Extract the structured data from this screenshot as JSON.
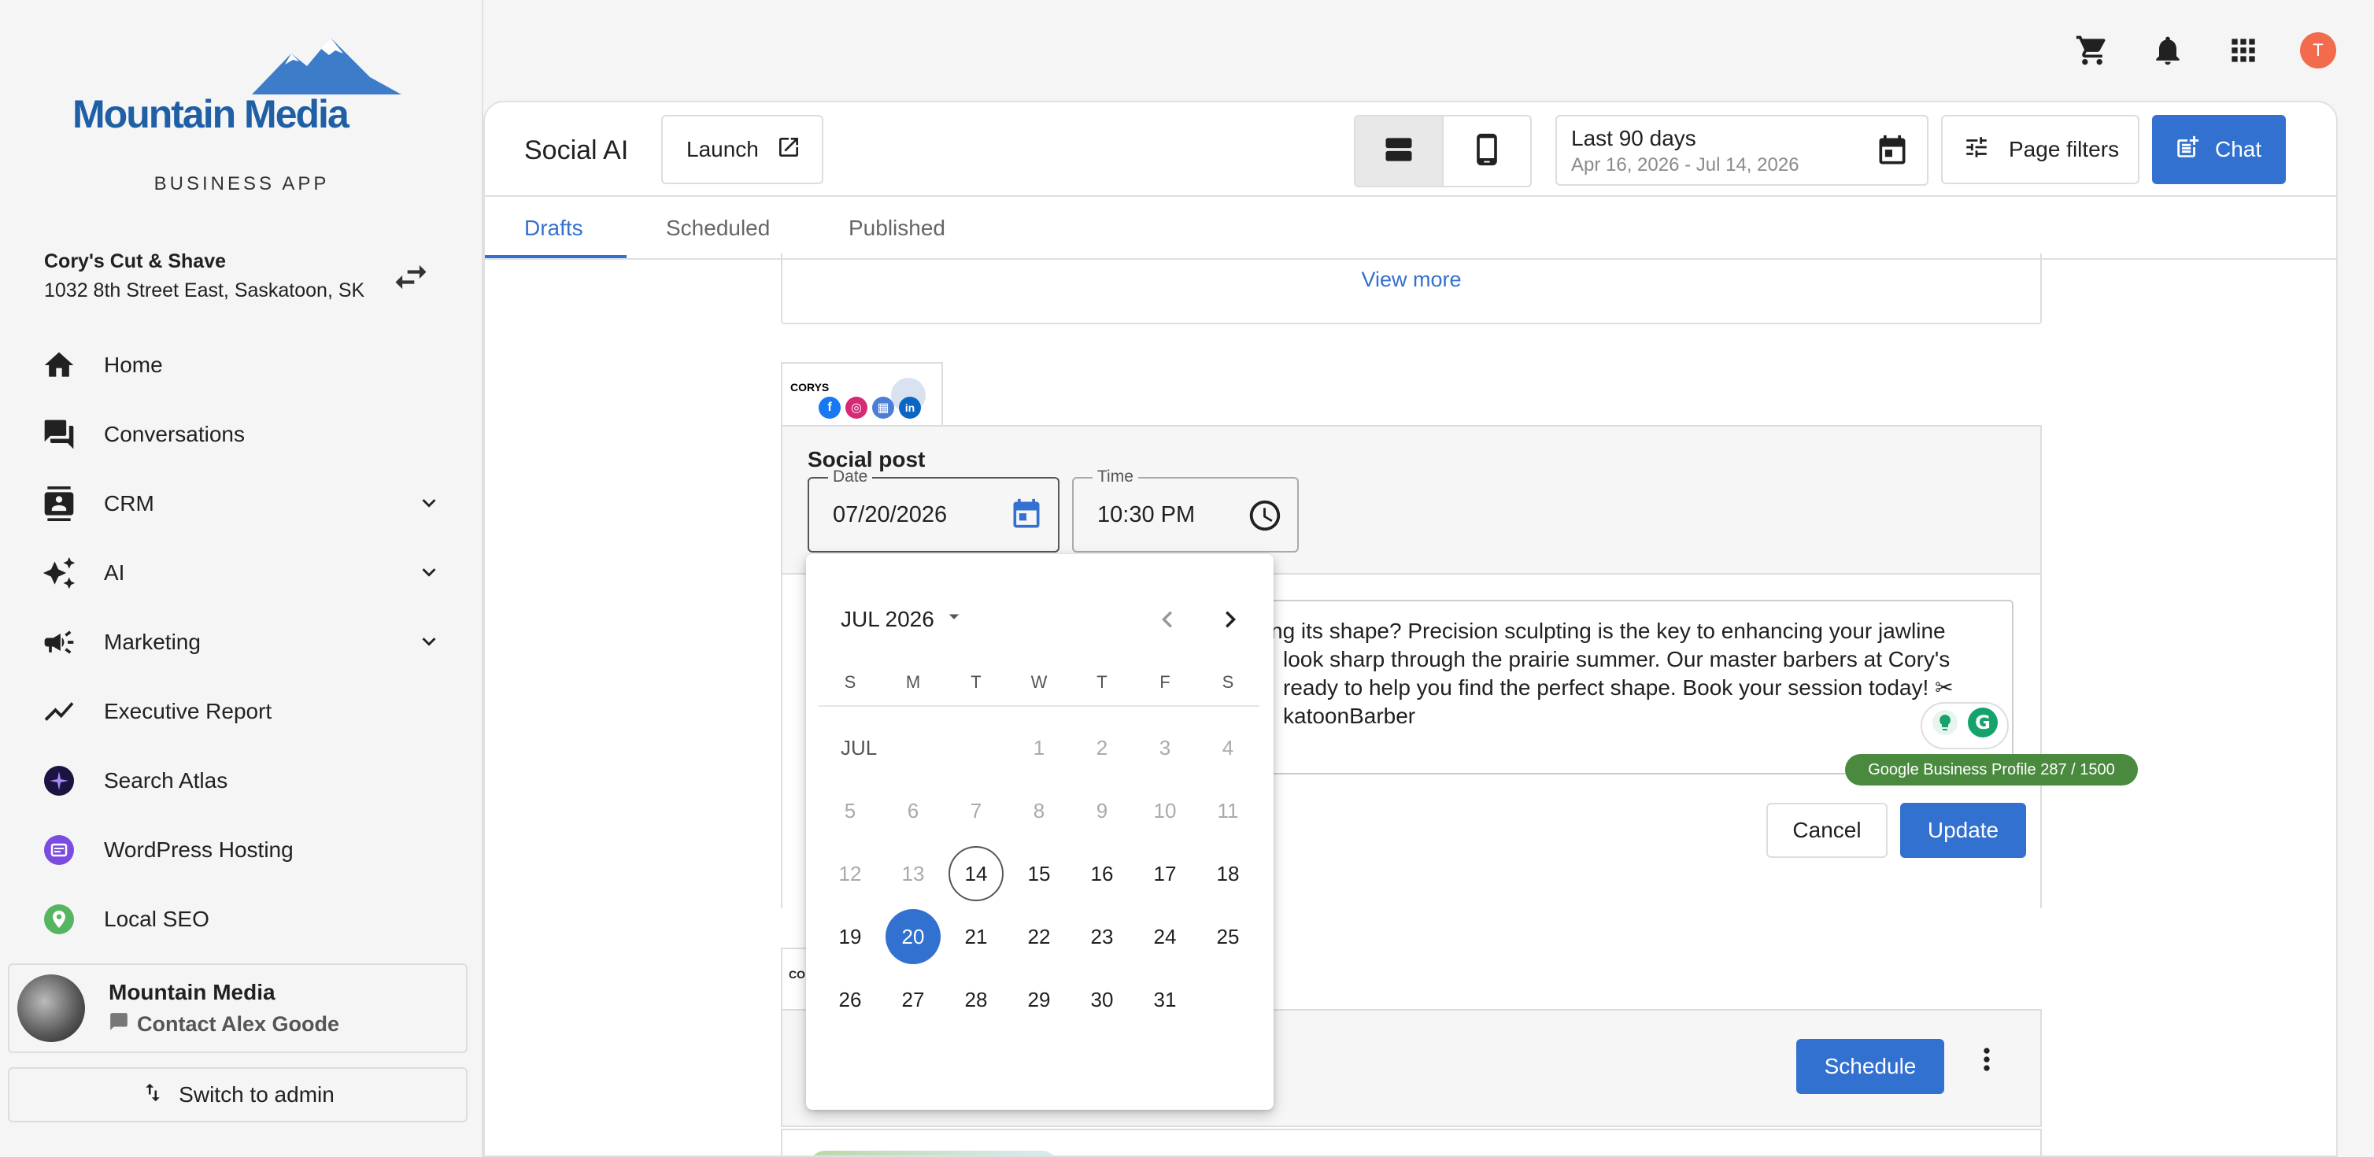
{
  "app": {
    "logo_text": "Mountain Media",
    "logo_subtitle": "BUSINESS APP",
    "brand_color": "#3371d0",
    "avatar_initial": "T",
    "avatar_color": "#f26b4d"
  },
  "business": {
    "name": "Cory's Cut & Shave",
    "address": "1032 8th Street East, Saskatoon, SK"
  },
  "sidebar": {
    "items": [
      {
        "label": "Home",
        "icon": "home-icon"
      },
      {
        "label": "Conversations",
        "icon": "chat-icon"
      },
      {
        "label": "CRM",
        "icon": "contacts-icon",
        "expandable": true
      },
      {
        "label": "AI",
        "icon": "sparkle-icon",
        "expandable": true
      },
      {
        "label": "Marketing",
        "icon": "megaphone-icon",
        "expandable": true
      },
      {
        "label": "Executive Report",
        "icon": "trend-icon"
      },
      {
        "label": "Search Atlas",
        "icon": "search-atlas-icon"
      },
      {
        "label": "WordPress Hosting",
        "icon": "wordpress-icon"
      },
      {
        "label": "Local SEO",
        "icon": "location-icon"
      }
    ],
    "account": {
      "org": "Mountain Media",
      "contact": "Contact Alex Goode"
    },
    "switch_admin": "Switch to admin"
  },
  "header": {
    "title": "Social AI",
    "launch_label": "Launch",
    "date_range": {
      "label": "Last 90 days",
      "sub": "Apr 16, 2026 - Jul 14, 2026"
    },
    "page_filters_label": "Page filters",
    "chat_label": "Chat"
  },
  "tabs": [
    {
      "label": "Drafts",
      "active": true
    },
    {
      "label": "Scheduled",
      "active": false
    },
    {
      "label": "Published",
      "active": false
    }
  ],
  "content": {
    "view_more": "View more",
    "brand_thumb": "CORYS",
    "post": {
      "title": "Social post",
      "date_label": "Date",
      "date_value": "07/20/2026",
      "time_label": "Time",
      "time_value": "10:30 PM",
      "text_lines": [
        "ng its shape? Precision sculpting is the key to enhancing your jawline",
        "look sharp through the prairie summer. Our master barbers at Cory's",
        "ready to help you find the perfect shape. Book your session today! ✂",
        "katoonBarber"
      ],
      "char_count": "Google Business Profile 287 / 1500",
      "cancel_label": "Cancel",
      "update_label": "Update"
    },
    "post2": {
      "schedule_label": "Schedule"
    }
  },
  "datepicker": {
    "month_label": "JUL 2026",
    "weekdays": [
      "S",
      "M",
      "T",
      "W",
      "T",
      "F",
      "S"
    ],
    "month_row_label": "JUL",
    "weeks": [
      [
        "",
        "",
        "",
        "1",
        "2",
        "3",
        "4"
      ],
      [
        "5",
        "6",
        "7",
        "8",
        "9",
        "10",
        "11"
      ],
      [
        "12",
        "13",
        "14",
        "15",
        "16",
        "17",
        "18"
      ],
      [
        "19",
        "20",
        "21",
        "22",
        "23",
        "24",
        "25"
      ],
      [
        "26",
        "27",
        "28",
        "29",
        "30",
        "31",
        ""
      ]
    ],
    "today": "14",
    "selected": "20",
    "last_disabled_day": 13
  }
}
